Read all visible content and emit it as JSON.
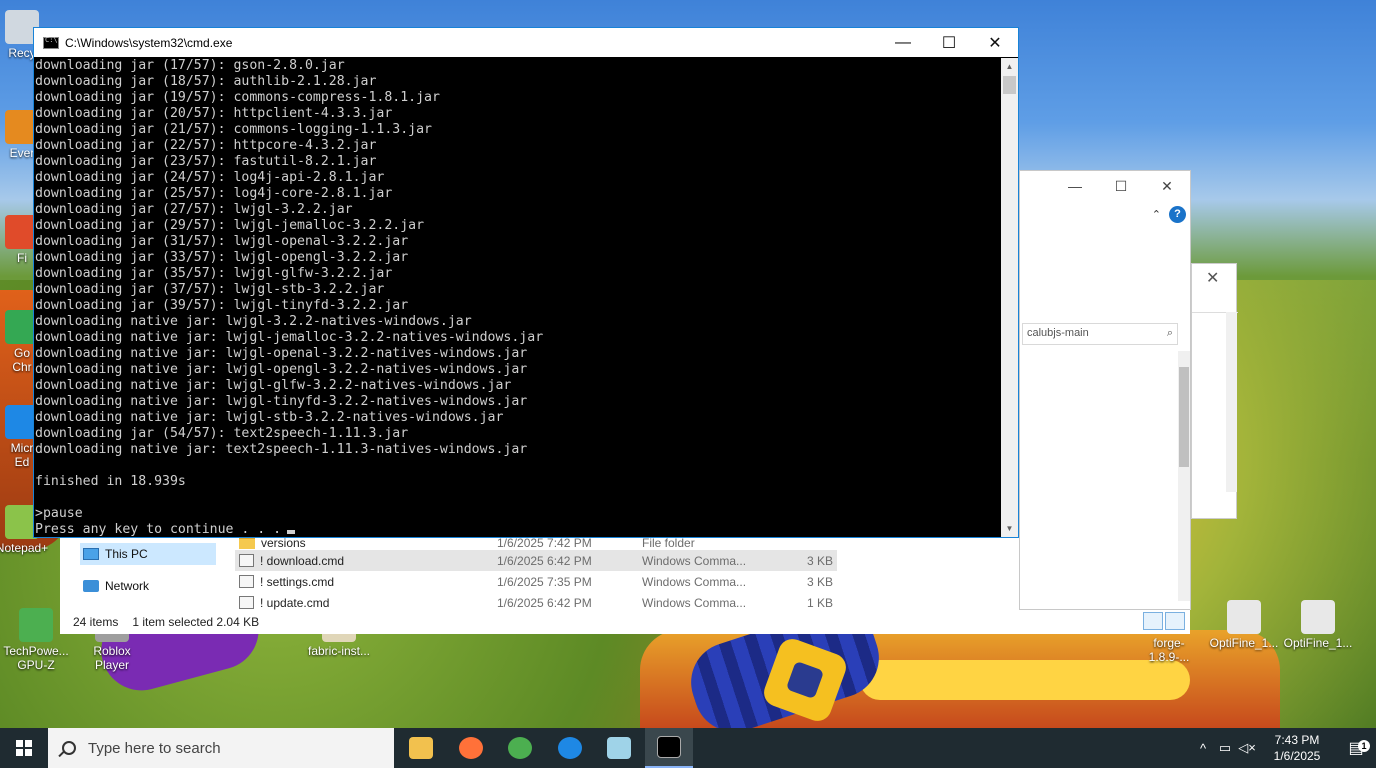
{
  "cmd_window": {
    "title": "C:\\Windows\\system32\\cmd.exe",
    "minimize": "—",
    "maximize": "☐",
    "close": "✕",
    "lines": [
      "downloading jar (17/57): gson-2.8.0.jar",
      "downloading jar (18/57): authlib-2.1.28.jar",
      "downloading jar (19/57): commons-compress-1.8.1.jar",
      "downloading jar (20/57): httpclient-4.3.3.jar",
      "downloading jar (21/57): commons-logging-1.1.3.jar",
      "downloading jar (22/57): httpcore-4.3.2.jar",
      "downloading jar (23/57): fastutil-8.2.1.jar",
      "downloading jar (24/57): log4j-api-2.8.1.jar",
      "downloading jar (25/57): log4j-core-2.8.1.jar",
      "downloading jar (27/57): lwjgl-3.2.2.jar",
      "downloading jar (29/57): lwjgl-jemalloc-3.2.2.jar",
      "downloading jar (31/57): lwjgl-openal-3.2.2.jar",
      "downloading jar (33/57): lwjgl-opengl-3.2.2.jar",
      "downloading jar (35/57): lwjgl-glfw-3.2.2.jar",
      "downloading jar (37/57): lwjgl-stb-3.2.2.jar",
      "downloading jar (39/57): lwjgl-tinyfd-3.2.2.jar",
      "downloading native jar: lwjgl-3.2.2-natives-windows.jar",
      "downloading native jar: lwjgl-jemalloc-3.2.2-natives-windows.jar",
      "downloading native jar: lwjgl-openal-3.2.2-natives-windows.jar",
      "downloading native jar: lwjgl-opengl-3.2.2-natives-windows.jar",
      "downloading native jar: lwjgl-glfw-3.2.2-natives-windows.jar",
      "downloading native jar: lwjgl-tinyfd-3.2.2-natives-windows.jar",
      "downloading native jar: lwjgl-stb-3.2.2-natives-windows.jar",
      "downloading jar (54/57): text2speech-1.11.3.jar",
      "downloading native jar: text2speech-1.11.3-natives-windows.jar",
      "",
      "finished in 18.939s",
      "",
      ">pause",
      "Press any key to continue . . ."
    ]
  },
  "explorer": {
    "minimize": "—",
    "maximize": "☐",
    "close": "✕",
    "expand": "⌃",
    "help": "?",
    "search_value": "calubjs-main",
    "search_icon": "search-icon",
    "nav": [
      {
        "label": "This PC",
        "icon": "computer-icon"
      },
      {
        "label": "Network",
        "icon": "network-icon"
      }
    ],
    "files": [
      {
        "name": "versions",
        "date": "1/6/2025 7:42 PM",
        "type": "File folder",
        "size": "",
        "icon": "folder-icon"
      },
      {
        "name": "! download.cmd",
        "date": "1/6/2025 6:42 PM",
        "type": "Windows Comma...",
        "size": "3 KB",
        "icon": "cmd-file-icon"
      },
      {
        "name": "! settings.cmd",
        "date": "1/6/2025 7:35 PM",
        "type": "Windows Comma...",
        "size": "3 KB",
        "icon": "cmd-file-icon"
      },
      {
        "name": "! update.cmd",
        "date": "1/6/2025 6:42 PM",
        "type": "Windows Comma...",
        "size": "1 KB",
        "icon": "cmd-file-icon"
      }
    ],
    "status_items": "24 items",
    "status_selected": "1 item selected  2.04 KB"
  },
  "dialog": {
    "close": "✕"
  },
  "desktop_icons": [
    {
      "label": "Recy",
      "color": "#d0d8e0"
    },
    {
      "label": "Ever",
      "color": "#e58a1f"
    },
    {
      "label": "Fi",
      "color": "#e04b2a"
    },
    {
      "label": "Go\nChr",
      "color": "#34a853"
    },
    {
      "label": "Micr\nEd",
      "color": "#1e88e5"
    },
    {
      "label": "Notepad+",
      "color": "#8bc34a"
    },
    {
      "label": "TechPowe...\nGPU-Z",
      "color": "#4caf50"
    },
    {
      "label": "Roblox\nPlayer",
      "color": "#9e9e9e"
    },
    {
      "label": "fabric-inst...",
      "color": "#e0d6b8"
    },
    {
      "label": "forge-1.8.9-...",
      "color": "#c7d9ee"
    },
    {
      "label": "OptiFine_1...",
      "color": "#e8e8e8"
    },
    {
      "label": "OptiFine_1...",
      "color": "#e8e8e8"
    }
  ],
  "taskbar": {
    "search_placeholder": "Type here to search",
    "apps": [
      {
        "name": "file-explorer-icon",
        "color": "#f2c14e"
      },
      {
        "name": "firefox-icon",
        "color": "#ff7139"
      },
      {
        "name": "chrome-icon",
        "color": "#4caf50"
      },
      {
        "name": "chrome-profile-icon",
        "color": "#1e88e5"
      },
      {
        "name": "notepad-icon",
        "color": "#9fd3e8"
      },
      {
        "name": "cmd-icon",
        "color": "#000000"
      }
    ],
    "tray_chevron": "^",
    "time": "7:43 PM",
    "date": "1/6/2025",
    "notifications_count": "1"
  }
}
